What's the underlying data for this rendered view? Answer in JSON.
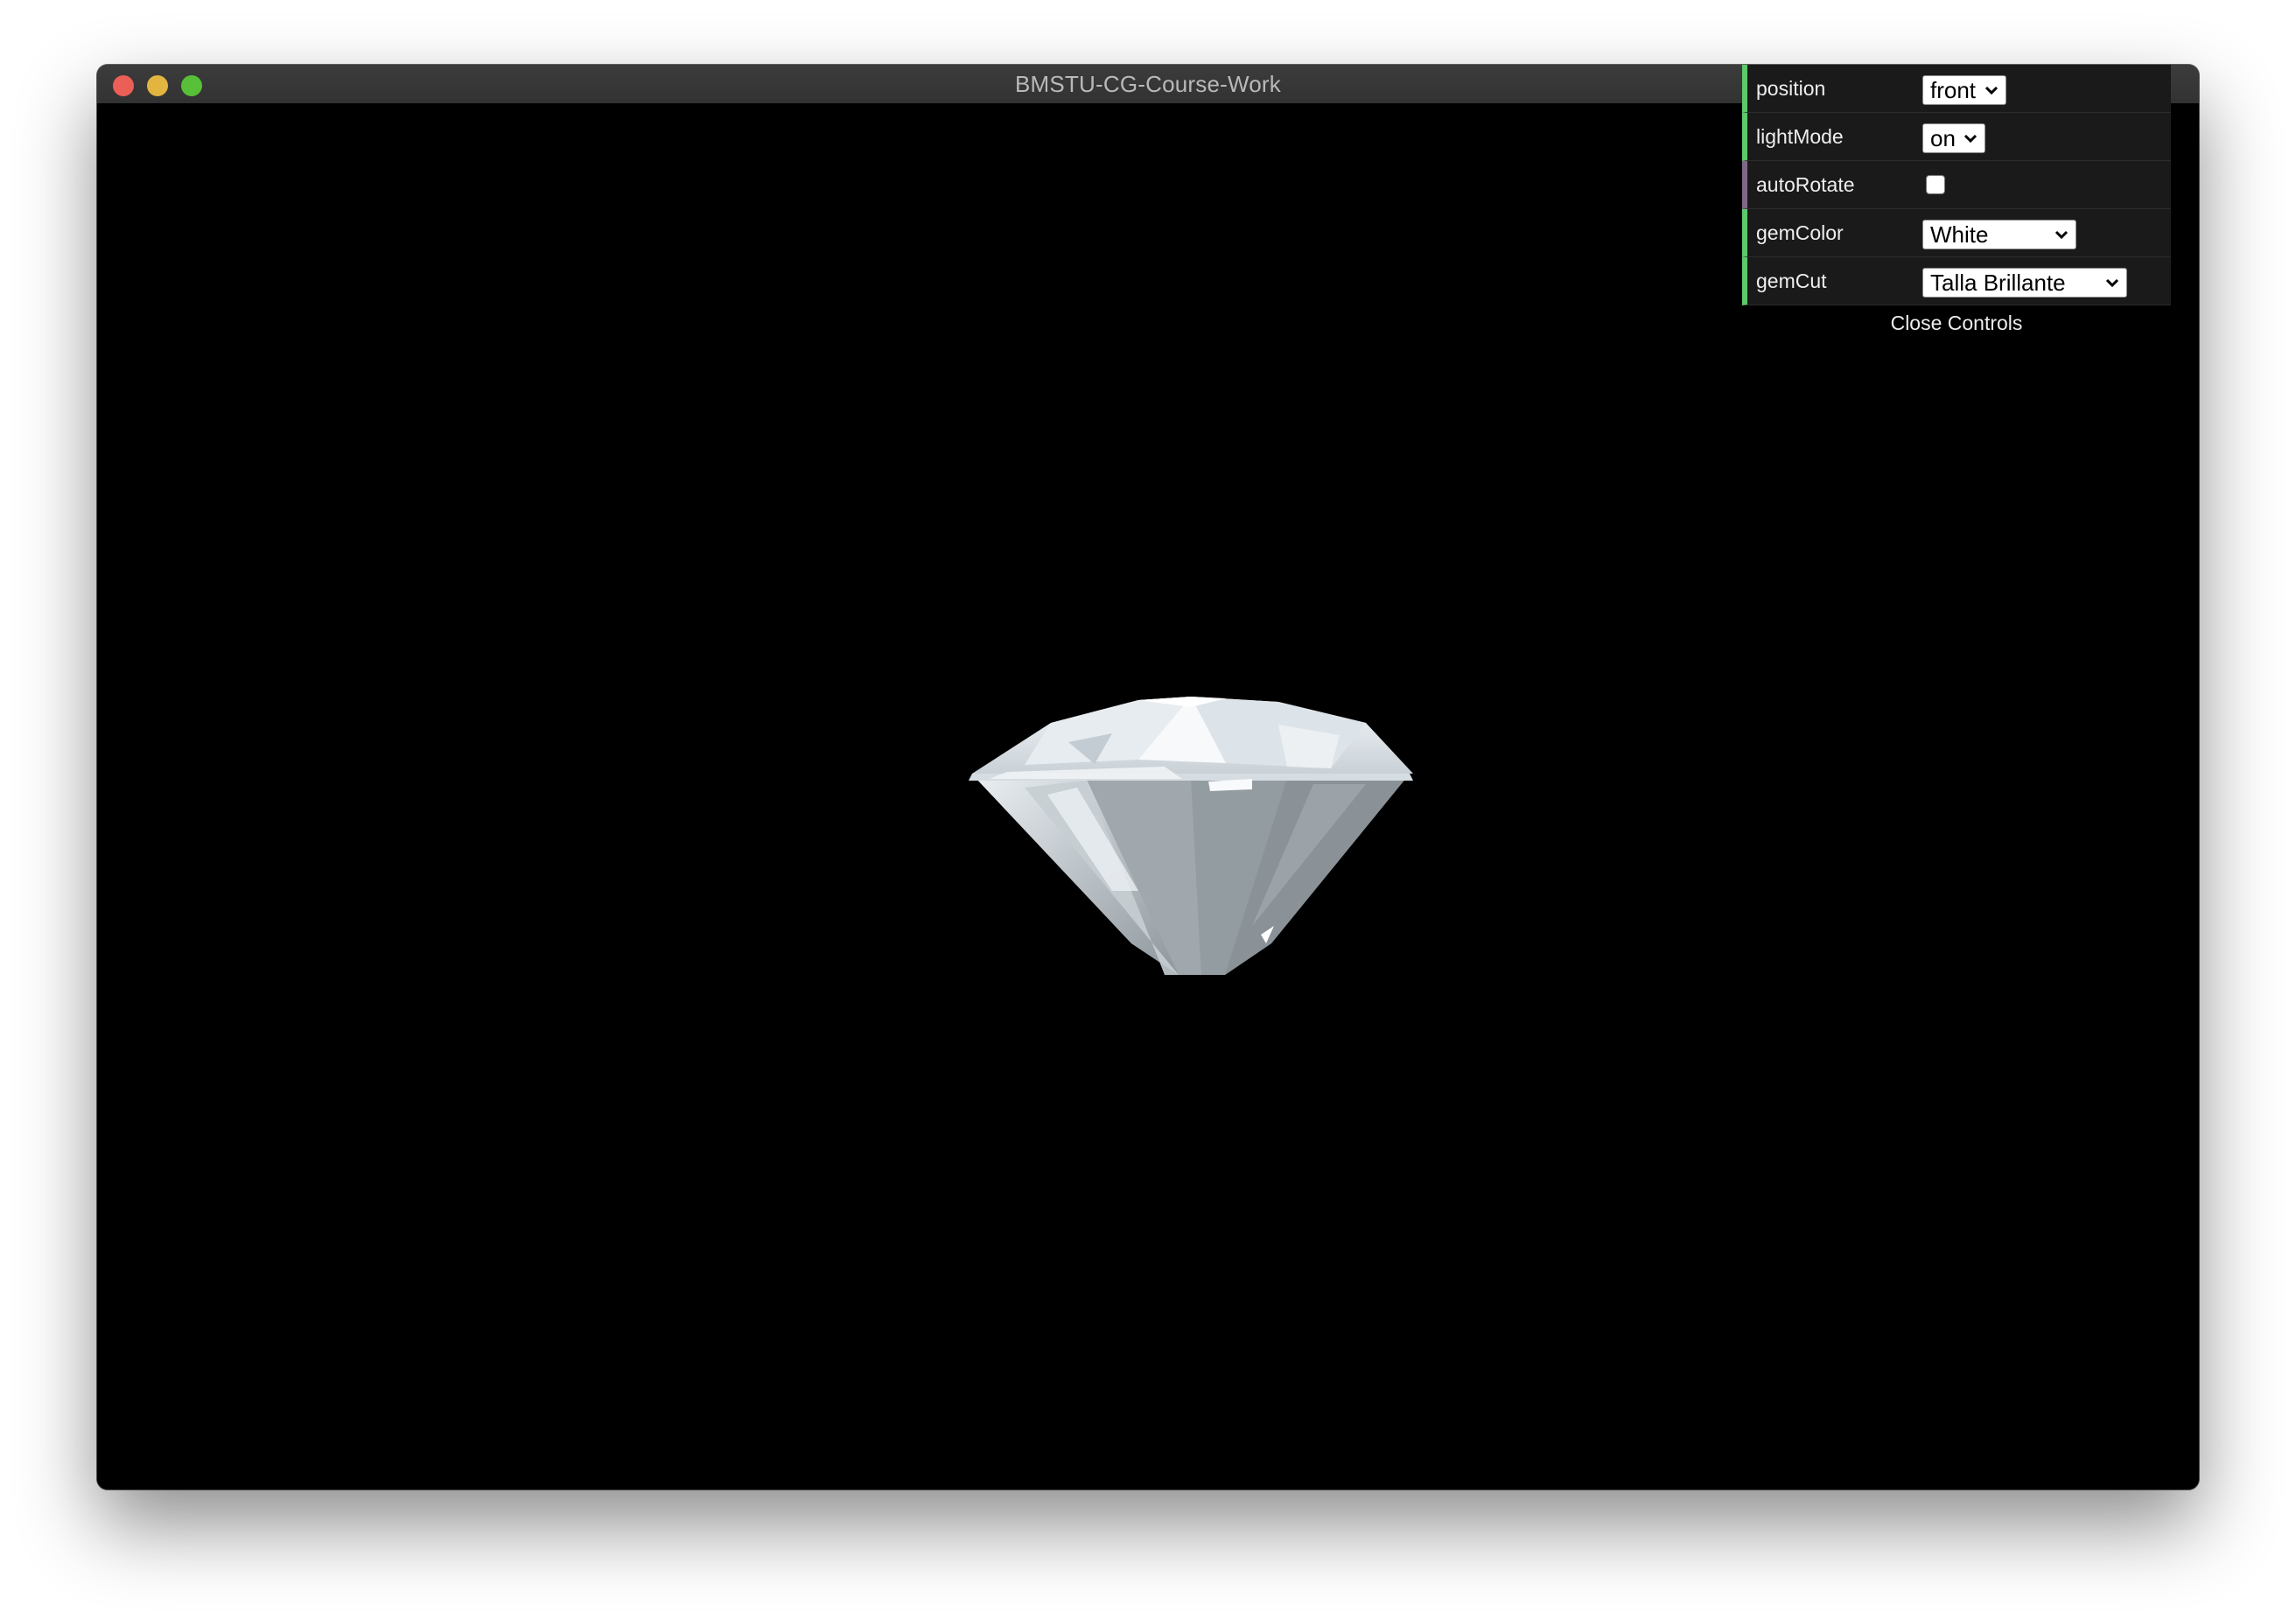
{
  "window": {
    "title": "BMSTU-CG-Course-Work",
    "buttons": [
      "close",
      "minimize",
      "zoom"
    ]
  },
  "controls": {
    "position": {
      "label": "position",
      "value": "front"
    },
    "lightMode": {
      "label": "lightMode",
      "value": "on"
    },
    "autoRotate": {
      "label": "autoRotate",
      "checked": false
    },
    "gemColor": {
      "label": "gemColor",
      "value": "White"
    },
    "gemCut": {
      "label": "gemCut",
      "value": "Talla Brillante"
    },
    "close_label": "Close Controls"
  },
  "scene": {
    "background": "#000000",
    "object": "diamond-gem"
  },
  "colors": {
    "accent_green": "#5ec96a",
    "accent_purple": "#806787",
    "panel_bg": "#1a1a1a"
  }
}
